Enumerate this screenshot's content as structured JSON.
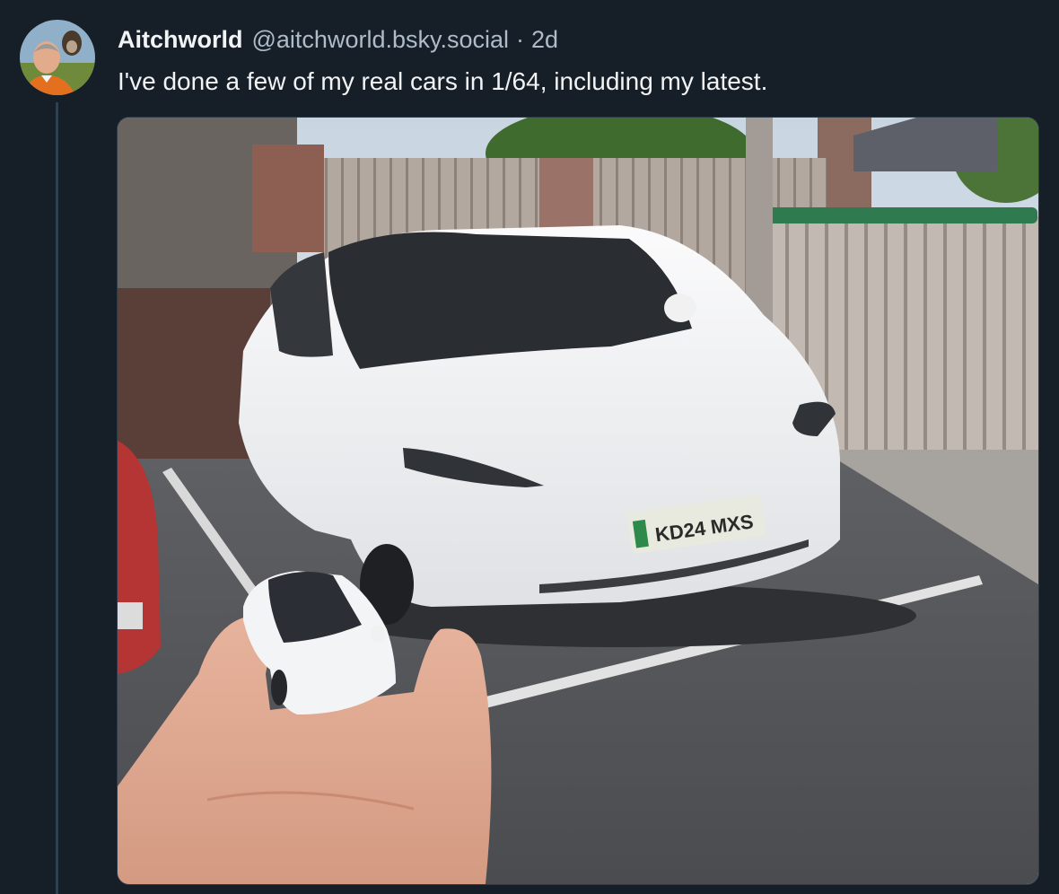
{
  "post": {
    "author": {
      "display_name": "Aitchworld",
      "handle": "@aitchworld.bsky.social",
      "avatar_icon": "avatar-photo"
    },
    "separator": "·",
    "timestamp": "2d",
    "text": "I've done a few of my real cars in 1/64, including my latest.",
    "image": {
      "icon": "photo"
    }
  },
  "colors": {
    "background": "#161e27",
    "text_primary": "#f1f3f5",
    "text_secondary": "#aebbc9",
    "thread_line": "#2e4052"
  }
}
